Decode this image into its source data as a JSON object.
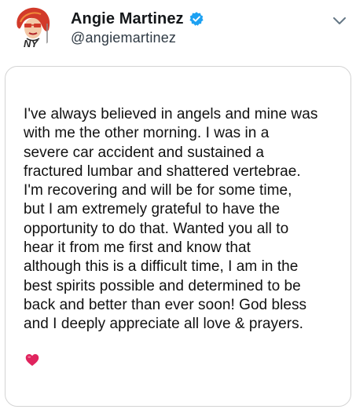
{
  "user": {
    "display_name": "Angie Martinez",
    "handle": "@angiemartinez",
    "avatar_text": "NY"
  },
  "post": {
    "text": "I've always believed in angels and mine was\nwith me the other morning.  I was in a\nsevere car accident and sustained a\nfractured lumbar and shattered vertebrae.\nI'm recovering and will be for some time,\nbut I am extremely grateful to have the\nopportunity to do that. Wanted you all to\nhear it from me first and know that\nalthough this is a difficult time, I am in the\nbest spirits possible and determined to be\nback and better than ever soon! God bless\nand I deeply appreciate all love & prayers.",
    "emoji": "heart-icon"
  },
  "colors": {
    "verified_badge": "#1da1f2",
    "heart": "#e0245e",
    "avatar_accent": "#d23a2a"
  }
}
